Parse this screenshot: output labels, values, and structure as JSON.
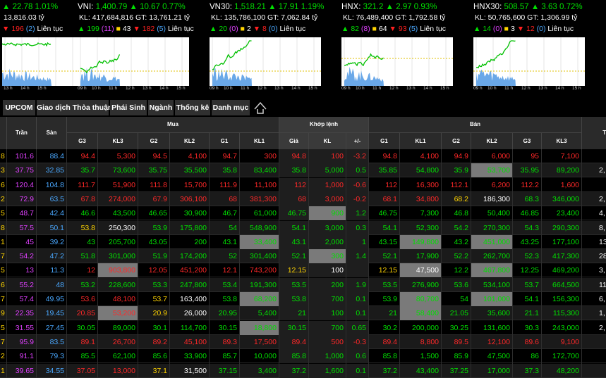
{
  "indices": [
    {
      "name": "",
      "value": "",
      "change": "22.78",
      "pct": "1.01%",
      "kl": "",
      "gt": "13,816.03 tỷ",
      "up": "",
      "ref": "",
      "flat": "",
      "down": "196",
      "ceil_floor": "(2)",
      "session": "Liên tục",
      "color": "g",
      "axis": [
        "13 h",
        "14 h",
        "15 h"
      ]
    },
    {
      "name": "VNI:",
      "value": "1,400.79",
      "change": "10.67",
      "pct": "0.77%",
      "kl": "KL: 417,684,816",
      "gt": "GT: 13,761.21 tỷ",
      "up": "199",
      "ref": "(11)",
      "flat": "43",
      "down": "182",
      "ceil_floor": "(5)",
      "session": "Liên tục",
      "color": "g",
      "axis": [
        "09 h",
        "10 h",
        "11 h",
        "12 h",
        "13 h",
        "14 h",
        "15 h"
      ]
    },
    {
      "name": "VN30:",
      "value": "1,518.21",
      "change": "17.91",
      "pct": "1.19%",
      "kl": "KL: 135,786,100",
      "gt": "GT: 7,062.84 tỷ",
      "up": "20",
      "ref": "(0)",
      "flat": "2",
      "down": "8",
      "ceil_floor": "(0)",
      "session": "Liên tục",
      "color": "g",
      "axis": [
        "09 h",
        "10 h",
        "11 h",
        "12 h",
        "13 h",
        "14 h",
        "15 h"
      ]
    },
    {
      "name": "HNX:",
      "value": "321.2",
      "change": "2.97",
      "pct": "0.93%",
      "kl": "KL: 76,489,400",
      "gt": "GT: 1,792.58 tỷ",
      "up": "82",
      "ref": "(8)",
      "flat": "64",
      "down": "93",
      "ceil_floor": "(5)",
      "session": "Liên tục",
      "color": "g",
      "axis": [
        "09 h",
        "10 h",
        "11 h",
        "12 h",
        "13 h",
        "14 h",
        "15 h"
      ]
    },
    {
      "name": "HNX30:",
      "value": "508.57",
      "change": "3.63",
      "pct": "0.72%",
      "kl": "KL: 50,765,600",
      "gt": "GT: 1,306.99 tỷ",
      "up": "14",
      "ref": "(0)",
      "flat": "3",
      "down": "12",
      "ceil_floor": "(0)",
      "session": "Liên tục",
      "color": "g",
      "axis": [
        "09 h",
        "10 h",
        "11 h",
        "12 h",
        "13 h",
        "14 h",
        "15 h"
      ]
    }
  ],
  "tabs": [
    "UPCOM",
    "Giao dịch Thỏa thuận",
    "Phái Sinh",
    "Ngành",
    "Thống kê",
    "Danh mục"
  ],
  "headers": {
    "tran": "Trần",
    "san": "Sàn",
    "mua": "Mua",
    "khop": "Khớp lệnh",
    "ban": "Bán",
    "tong": "Tổ",
    "sub": [
      "G3",
      "KL3",
      "G2",
      "KL2",
      "G1",
      "KL1",
      "Giá",
      "KL",
      "+/-",
      "G1",
      "KL1",
      "G2",
      "KL2",
      "G3",
      "KL3"
    ]
  },
  "rows": [
    {
      "ref": "8",
      "tran": "101.6",
      "san": "88.4",
      "cells": [
        [
          "94.4",
          "r"
        ],
        [
          "5,300",
          "r"
        ],
        [
          "94.5",
          "r"
        ],
        [
          "4,100",
          "r"
        ],
        [
          "94.7",
          "r"
        ],
        [
          "300",
          "r"
        ],
        [
          "94.8",
          "r"
        ],
        [
          "100",
          "r"
        ],
        [
          "-3.2",
          "r"
        ],
        [
          "94.8",
          "r"
        ],
        [
          "4,100",
          "r"
        ],
        [
          "94.9",
          "r"
        ],
        [
          "6,000",
          "r"
        ],
        [
          "95",
          "r"
        ],
        [
          "7,100",
          "r"
        ]
      ],
      "tong": ""
    },
    {
      "ref": "3",
      "tran": "37.75",
      "san": "32.85",
      "cells": [
        [
          "35.7",
          "g"
        ],
        [
          "73,600",
          "g"
        ],
        [
          "35.75",
          "g"
        ],
        [
          "35,500",
          "g"
        ],
        [
          "35.8",
          "g"
        ],
        [
          "83,400",
          "g"
        ],
        [
          "35.8",
          "g"
        ],
        [
          "5,000",
          "g"
        ],
        [
          "0.5",
          "g"
        ],
        [
          "35.85",
          "g"
        ],
        [
          "54,800",
          "g"
        ],
        [
          "35.9",
          "g"
        ],
        [
          "53,700",
          "g",
          "hl"
        ],
        [
          "35.95",
          "g"
        ],
        [
          "89,200",
          "g"
        ]
      ],
      "tong": "2,"
    },
    {
      "ref": "6",
      "tran": "120.4",
      "san": "104.8",
      "cells": [
        [
          "111.7",
          "r"
        ],
        [
          "51,900",
          "r"
        ],
        [
          "111.8",
          "r"
        ],
        [
          "15,700",
          "r"
        ],
        [
          "111.9",
          "r"
        ],
        [
          "11,100",
          "r"
        ],
        [
          "112",
          "r"
        ],
        [
          "1,000",
          "r"
        ],
        [
          "-0.6",
          "r"
        ],
        [
          "112",
          "r"
        ],
        [
          "16,300",
          "r"
        ],
        [
          "112.1",
          "r"
        ],
        [
          "6,200",
          "r"
        ],
        [
          "112.2",
          "r"
        ],
        [
          "1,600",
          "r"
        ]
      ],
      "tong": ""
    },
    {
      "ref": "2",
      "tran": "72.9",
      "san": "63.5",
      "cells": [
        [
          "67.8",
          "r"
        ],
        [
          "274,000",
          "r"
        ],
        [
          "67.9",
          "r"
        ],
        [
          "306,100",
          "r"
        ],
        [
          "68",
          "r"
        ],
        [
          "381,300",
          "r"
        ],
        [
          "68",
          "r"
        ],
        [
          "3,000",
          "r"
        ],
        [
          "-0.2",
          "r"
        ],
        [
          "68.1",
          "r"
        ],
        [
          "34,800",
          "r"
        ],
        [
          "68.2",
          "y"
        ],
        [
          "186,300",
          "w"
        ],
        [
          "68.3",
          "g"
        ],
        [
          "346,000",
          "g"
        ]
      ],
      "tong": "2,"
    },
    {
      "ref": "5",
      "tran": "48.7",
      "san": "42.4",
      "cells": [
        [
          "46.6",
          "g"
        ],
        [
          "43,500",
          "g"
        ],
        [
          "46.65",
          "g"
        ],
        [
          "30,900",
          "g"
        ],
        [
          "46.7",
          "g"
        ],
        [
          "61,000",
          "g"
        ],
        [
          "46.75",
          "g"
        ],
        [
          "900",
          "g",
          "hl"
        ],
        [
          "1.2",
          "g"
        ],
        [
          "46.75",
          "g"
        ],
        [
          "7,300",
          "g"
        ],
        [
          "46.8",
          "g"
        ],
        [
          "50,400",
          "g"
        ],
        [
          "46.85",
          "g"
        ],
        [
          "23,400",
          "g"
        ]
      ],
      "tong": "4,"
    },
    {
      "ref": "8",
      "tran": "57.5",
      "san": "50.1",
      "cells": [
        [
          "53.8",
          "y"
        ],
        [
          "250,300",
          "w"
        ],
        [
          "53.9",
          "g"
        ],
        [
          "175,800",
          "g"
        ],
        [
          "54",
          "g"
        ],
        [
          "548,900",
          "g"
        ],
        [
          "54.1",
          "g"
        ],
        [
          "3,000",
          "g"
        ],
        [
          "0.3",
          "g"
        ],
        [
          "54.1",
          "g"
        ],
        [
          "52,300",
          "g"
        ],
        [
          "54.2",
          "g"
        ],
        [
          "270,300",
          "g"
        ],
        [
          "54.3",
          "g"
        ],
        [
          "290,300",
          "g"
        ]
      ],
      "tong": "8,"
    },
    {
      "ref": "1",
      "tran": "45",
      "san": "39.2",
      "cells": [
        [
          "43",
          "g"
        ],
        [
          "205,700",
          "g"
        ],
        [
          "43.05",
          "g"
        ],
        [
          "200",
          "g"
        ],
        [
          "43.1",
          "g"
        ],
        [
          "33,400",
          "g",
          "hl"
        ],
        [
          "43.1",
          "g"
        ],
        [
          "2,000",
          "g"
        ],
        [
          "1",
          "g"
        ],
        [
          "43.15",
          "g"
        ],
        [
          "149,800",
          "g",
          "hl"
        ],
        [
          "43.2",
          "g"
        ],
        [
          "451,000",
          "g",
          "hl"
        ],
        [
          "43.25",
          "g"
        ],
        [
          "177,100",
          "g"
        ]
      ],
      "tong": "13,"
    },
    {
      "ref": "7",
      "tran": "54.2",
      "san": "47.2",
      "cells": [
        [
          "51.8",
          "g"
        ],
        [
          "301,000",
          "g"
        ],
        [
          "51.9",
          "g"
        ],
        [
          "174,200",
          "g"
        ],
        [
          "52",
          "g"
        ],
        [
          "301,400",
          "g"
        ],
        [
          "52.1",
          "g"
        ],
        [
          "300",
          "g",
          "hl"
        ],
        [
          "1.4",
          "g"
        ],
        [
          "52.1",
          "g"
        ],
        [
          "17,900",
          "g"
        ],
        [
          "52.2",
          "g"
        ],
        [
          "262,700",
          "g"
        ],
        [
          "52.3",
          "g"
        ],
        [
          "417,300",
          "g"
        ]
      ],
      "tong": "28,"
    },
    {
      "ref": "5",
      "tran": "13",
      "san": "11.3",
      "cells": [
        [
          "12",
          "r"
        ],
        [
          "903,800",
          "r",
          "hl"
        ],
        [
          "12.05",
          "r"
        ],
        [
          "451,200",
          "r"
        ],
        [
          "12.1",
          "r"
        ],
        [
          "743,200",
          "r"
        ],
        [
          "12.15",
          "y"
        ],
        [
          "100",
          "w"
        ],
        [
          "",
          "w"
        ],
        [
          "12.15",
          "y"
        ],
        [
          "47,500",
          "w",
          "hl"
        ],
        [
          "12.2",
          "g"
        ],
        [
          "467,800",
          "g",
          "hl"
        ],
        [
          "12.25",
          "g"
        ],
        [
          "469,200",
          "g"
        ]
      ],
      "tong": "3,"
    },
    {
      "ref": "6",
      "tran": "55.2",
      "san": "48",
      "cells": [
        [
          "53.2",
          "g"
        ],
        [
          "228,600",
          "g"
        ],
        [
          "53.3",
          "g"
        ],
        [
          "247,800",
          "g"
        ],
        [
          "53.4",
          "g"
        ],
        [
          "191,300",
          "g"
        ],
        [
          "53.5",
          "g"
        ],
        [
          "200",
          "g"
        ],
        [
          "1.9",
          "g"
        ],
        [
          "53.5",
          "g"
        ],
        [
          "276,900",
          "g"
        ],
        [
          "53.6",
          "g"
        ],
        [
          "534,100",
          "g"
        ],
        [
          "53.7",
          "g"
        ],
        [
          "664,500",
          "g"
        ]
      ],
      "tong": "11,"
    },
    {
      "ref": "7",
      "tran": "57.4",
      "san": "49.95",
      "cells": [
        [
          "53.6",
          "r"
        ],
        [
          "48,100",
          "r"
        ],
        [
          "53.7",
          "y"
        ],
        [
          "163,400",
          "w"
        ],
        [
          "53.8",
          "g"
        ],
        [
          "68,200",
          "g",
          "hl"
        ],
        [
          "53.8",
          "g"
        ],
        [
          "700",
          "g"
        ],
        [
          "0.1",
          "g"
        ],
        [
          "53.9",
          "g"
        ],
        [
          "80,700",
          "g",
          "hl"
        ],
        [
          "54",
          "g"
        ],
        [
          "101,000",
          "g",
          "hl"
        ],
        [
          "54.1",
          "g"
        ],
        [
          "156,300",
          "g"
        ]
      ],
      "tong": "6,"
    },
    {
      "ref": "9",
      "tran": "22.35",
      "san": "19.45",
      "cells": [
        [
          "20.85",
          "r"
        ],
        [
          "53,200",
          "r",
          "hl"
        ],
        [
          "20.9",
          "y"
        ],
        [
          "26,000",
          "w"
        ],
        [
          "20.95",
          "g"
        ],
        [
          "5,400",
          "g"
        ],
        [
          "21",
          "g"
        ],
        [
          "100",
          "g"
        ],
        [
          "0.1",
          "g"
        ],
        [
          "21",
          "g"
        ],
        [
          "58,400",
          "g",
          "hl"
        ],
        [
          "21.05",
          "g"
        ],
        [
          "35,600",
          "g"
        ],
        [
          "21.1",
          "g"
        ],
        [
          "115,300",
          "g"
        ]
      ],
      "tong": "1,"
    },
    {
      "ref": "5",
      "tran": "31.55",
      "san": "27.45",
      "cells": [
        [
          "30.05",
          "g"
        ],
        [
          "89,000",
          "g"
        ],
        [
          "30.1",
          "g"
        ],
        [
          "114,700",
          "g"
        ],
        [
          "30.15",
          "g"
        ],
        [
          "18,800",
          "g",
          "hl"
        ],
        [
          "30.15",
          "g"
        ],
        [
          "700",
          "g"
        ],
        [
          "0.65",
          "g"
        ],
        [
          "30.2",
          "g"
        ],
        [
          "200,000",
          "g"
        ],
        [
          "30.25",
          "g"
        ],
        [
          "131,600",
          "g"
        ],
        [
          "30.3",
          "g"
        ],
        [
          "243,000",
          "g"
        ]
      ],
      "tong": "2,"
    },
    {
      "ref": "7",
      "tran": "95.9",
      "san": "83.5",
      "cells": [
        [
          "89.1",
          "r"
        ],
        [
          "26,700",
          "r"
        ],
        [
          "89.2",
          "r"
        ],
        [
          "45,100",
          "r"
        ],
        [
          "89.3",
          "r"
        ],
        [
          "17,500",
          "r"
        ],
        [
          "89.4",
          "r"
        ],
        [
          "500",
          "r"
        ],
        [
          "-0.3",
          "r"
        ],
        [
          "89.4",
          "r"
        ],
        [
          "8,800",
          "r"
        ],
        [
          "89.5",
          "r"
        ],
        [
          "12,100",
          "r"
        ],
        [
          "89.6",
          "r"
        ],
        [
          "9,100",
          "r"
        ]
      ],
      "tong": ""
    },
    {
      "ref": "2",
      "tran": "91.1",
      "san": "79.3",
      "cells": [
        [
          "85.5",
          "g"
        ],
        [
          "62,100",
          "g"
        ],
        [
          "85.6",
          "g"
        ],
        [
          "33,900",
          "g"
        ],
        [
          "85.7",
          "g"
        ],
        [
          "10,000",
          "g"
        ],
        [
          "85.8",
          "g"
        ],
        [
          "1,000",
          "g"
        ],
        [
          "0.6",
          "g"
        ],
        [
          "85.8",
          "g"
        ],
        [
          "1,500",
          "g"
        ],
        [
          "85.9",
          "g"
        ],
        [
          "47,500",
          "g"
        ],
        [
          "86",
          "g"
        ],
        [
          "172,700",
          "g"
        ]
      ],
      "tong": ""
    },
    {
      "ref": "1",
      "tran": "39.65",
      "san": "34.55",
      "cells": [
        [
          "37.05",
          "r"
        ],
        [
          "13,000",
          "r"
        ],
        [
          "37.1",
          "y"
        ],
        [
          "31,500",
          "w"
        ],
        [
          "37.15",
          "g"
        ],
        [
          "3,400",
          "g"
        ],
        [
          "37.2",
          "g"
        ],
        [
          "1,600",
          "g"
        ],
        [
          "0.1",
          "g"
        ],
        [
          "37.2",
          "g"
        ],
        [
          "43,400",
          "g"
        ],
        [
          "37.25",
          "g"
        ],
        [
          "17,000",
          "g"
        ],
        [
          "37.3",
          "g"
        ],
        [
          "48,200",
          "g"
        ]
      ],
      "tong": ""
    }
  ]
}
